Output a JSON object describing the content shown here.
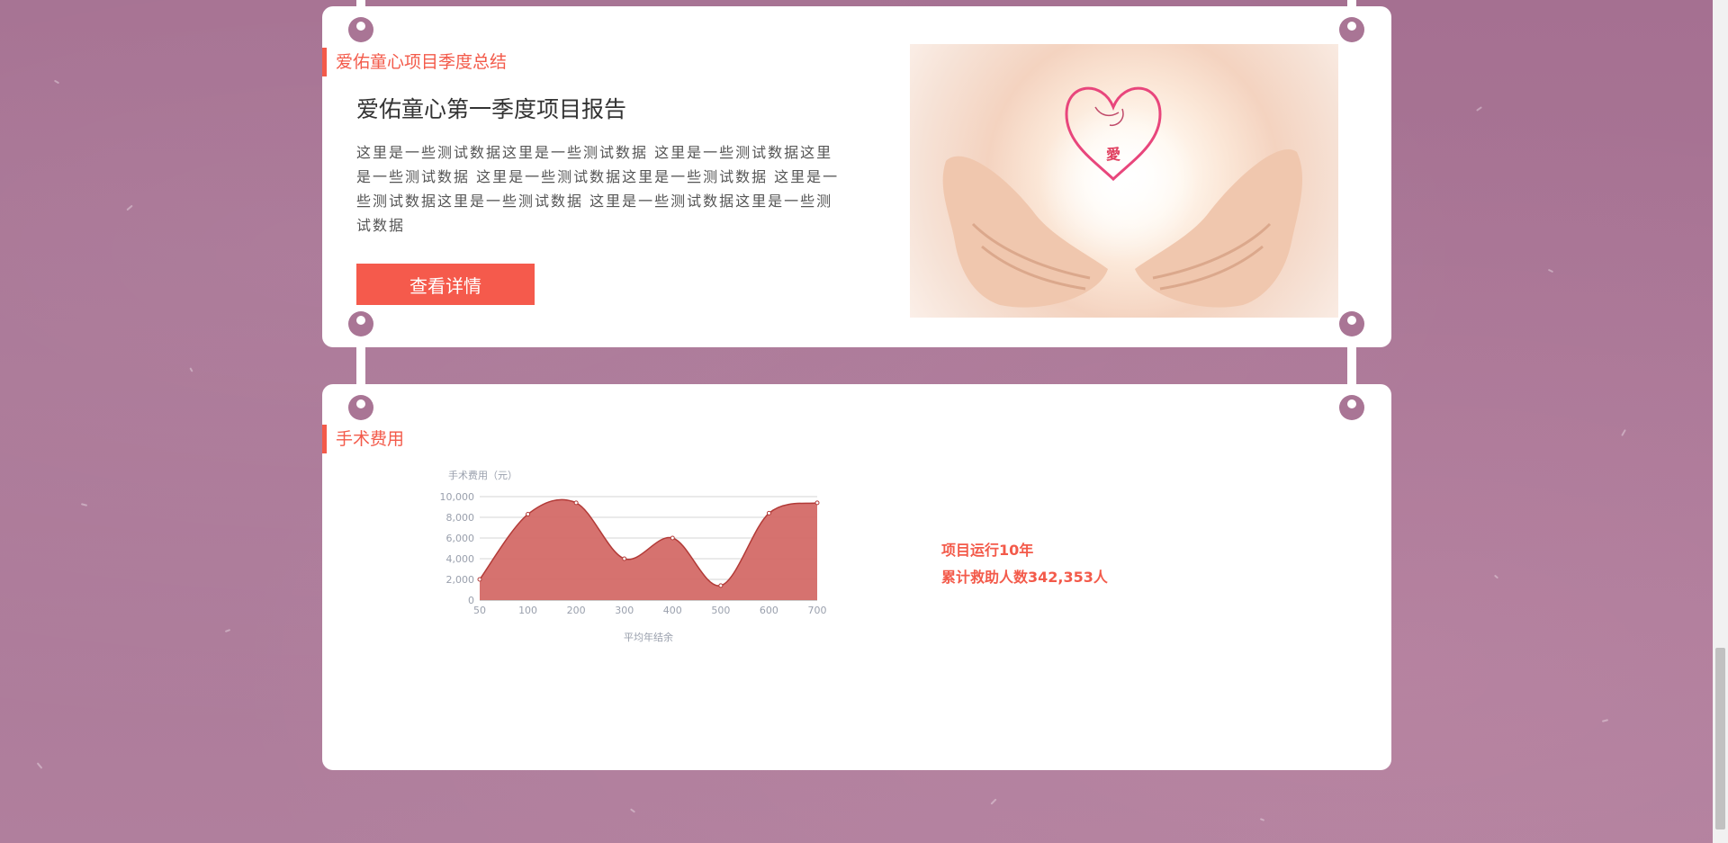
{
  "section1": {
    "heading": "爱佑童心项目季度总结",
    "report_title": "爱佑童心第一季度项目报告",
    "report_body": "这里是一些测试数据这里是一些测试数据 这里是一些测试数据这里是一些测试数据 这里是一些测试数据这里是一些测试数据 这里是一些测试数据这里是一些测试数据 这里是一些测试数据这里是一些测试数据",
    "button_label": "查看详情",
    "image_caption": "愛"
  },
  "section2": {
    "heading": "手术费用",
    "stats_line1": "项目运行10年",
    "stats_line2": "累计救助人数342,353人"
  },
  "colors": {
    "accent": "#f35a4a",
    "button": "#f55a4c",
    "background": "#a97595",
    "chart_fill": "#d46a67",
    "chart_line": "#b23a37"
  },
  "chart_data": {
    "type": "area",
    "title": "",
    "ylabel": "手术费用（元）",
    "xlabel": "平均年结余",
    "x": [
      "50",
      "100",
      "200",
      "300",
      "400",
      "500",
      "600",
      "700"
    ],
    "values": [
      2000,
      8300,
      9400,
      4000,
      6000,
      1400,
      8400,
      9400
    ],
    "ylim": [
      0,
      10000
    ],
    "yticks": [
      "0",
      "2,000",
      "4,000",
      "6,000",
      "8,000",
      "10,000"
    ],
    "grid": true
  }
}
